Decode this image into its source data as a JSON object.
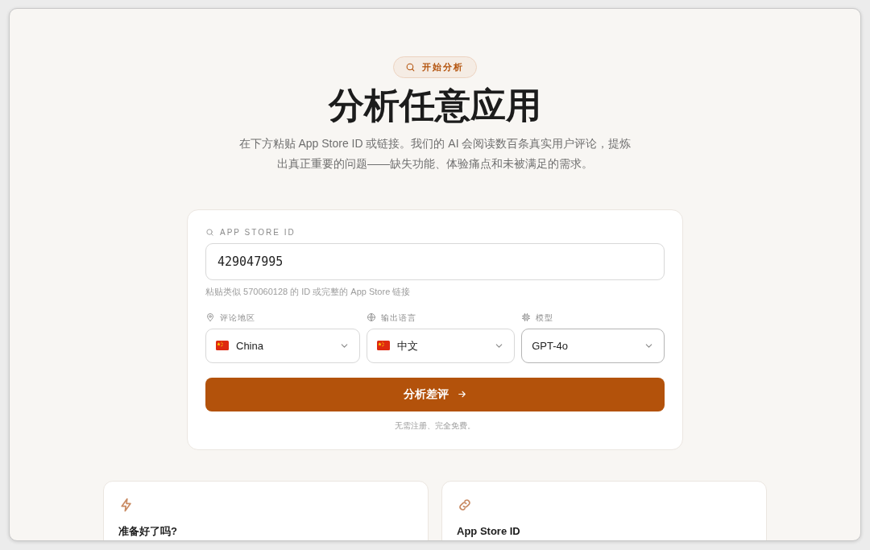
{
  "badge": {
    "label": "开始分析"
  },
  "hero": {
    "title": "分析任意应用",
    "subtitle": "在下方粘贴 App Store ID 或链接。我们的 AI 会阅读数百条真实用户评论，提炼出真正重要的问题——缺失功能、体验痛点和未被满足的需求。"
  },
  "form": {
    "id_label": "APP STORE ID",
    "id_value": "429047995",
    "id_hint": "粘贴类似 570060128 的 ID 或完整的 App Store 链接",
    "selects": [
      {
        "kind": "region",
        "label": "评论地区",
        "value": "China",
        "flag": true
      },
      {
        "kind": "language",
        "label": "输出语言",
        "value": "中文",
        "flag": true
      },
      {
        "kind": "model",
        "label": "模型",
        "value": "GPT-4o",
        "flag": false
      }
    ],
    "submit": "分析差评",
    "note": "无需注册、完全免费。"
  },
  "features": [
    {
      "kind": "bolt",
      "title": "准备好了吗?"
    },
    {
      "kind": "link",
      "title": "App Store ID"
    }
  ]
}
